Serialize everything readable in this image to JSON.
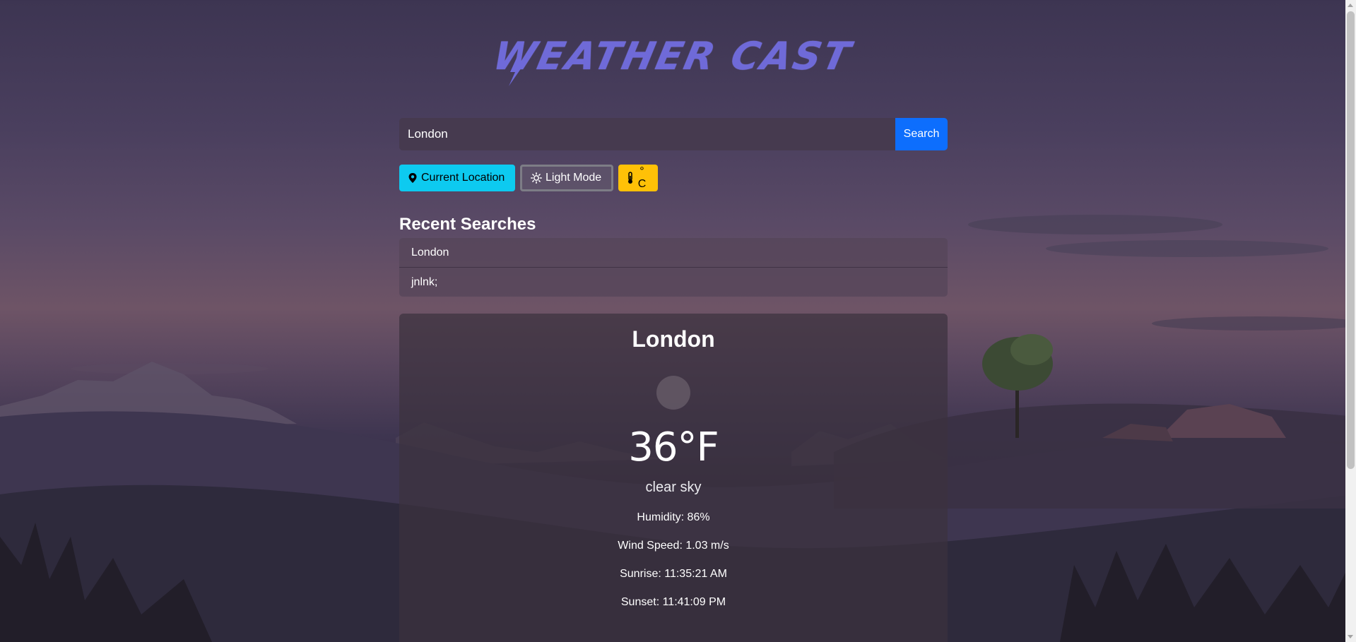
{
  "app": {
    "logo_text": "WEATHER CAST"
  },
  "search": {
    "value": "London",
    "placeholder": "",
    "button_label": "Search"
  },
  "actions": {
    "current_location_label": "Current Location",
    "light_mode_label": "Light Mode",
    "unit_label": "° C"
  },
  "recent": {
    "title": "Recent Searches",
    "items": [
      "London",
      "jnlnk;"
    ]
  },
  "weather": {
    "city": "London",
    "temperature": "36°F",
    "description": "clear sky",
    "humidity": "Humidity: 86%",
    "wind_speed": "Wind Speed: 1.03 m/s",
    "sunrise": "Sunrise: 11:35:21 AM",
    "sunset": "Sunset: 11:41:09 PM"
  },
  "colors": {
    "search_button": "#0d6efd",
    "location_button": "#0dcaf0",
    "unit_button": "#ffc107",
    "logo": "#6f6ad8"
  },
  "icons": {
    "location": "location-pin-icon",
    "light_mode": "sun-icon",
    "unit": "thermometer-icon",
    "weather": "weather-condition-icon"
  }
}
